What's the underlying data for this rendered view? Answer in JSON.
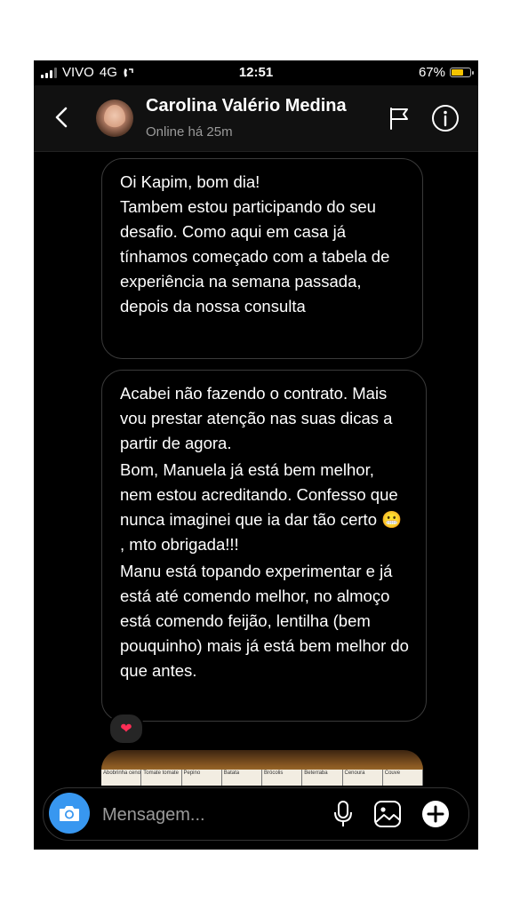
{
  "status_bar": {
    "carrier": "VIVO",
    "network": "4G",
    "time": "12:51",
    "battery": "67%",
    "battery_level": 0.67,
    "battery_color": "#f5c400"
  },
  "header": {
    "back_icon": "chevron-left-icon",
    "contact_name": "Carolina Valério Medina",
    "contact_status": "Online há 25m",
    "flag_icon": "flag-icon",
    "info_icon": "info-icon"
  },
  "messages": [
    {
      "paragraphs": [
        "Oi Kapim, bom dia!",
        "Tambem estou participando do seu desafio. Como aqui em casa já tínhamos começado com a tabela de experiência na semana passada, depois da nossa consulta"
      ]
    },
    {
      "paragraphs": [
        "Acabei não fazendo o contrato. Mais vou prestar atenção nas suas dicas a partir de agora.",
        "Bom, Manuela já está bem melhor, nem estou acreditando. Confesso que nunca imaginei que ia dar tão certo 😬 , mto obrigada!!!",
        "Manu está topando experimentar e já está até comendo melhor, no almoço está comendo feijão, lentilha (bem pouquinho) mais já está bem melhor do que antes."
      ],
      "reaction": "❤"
    }
  ],
  "image_preview": {
    "labels": [
      "Abobrinha cenoura",
      "Tomate tomate",
      "Pepino",
      "Batata",
      "Brócolis",
      "Beterraba",
      "Cenoura",
      "Couve"
    ]
  },
  "composer": {
    "placeholder": "Mensagem...",
    "camera_icon": "camera-icon",
    "mic_icon": "microphone-icon",
    "gallery_icon": "gallery-icon",
    "add_icon": "add-icon",
    "accent_color": "#3897f0"
  }
}
